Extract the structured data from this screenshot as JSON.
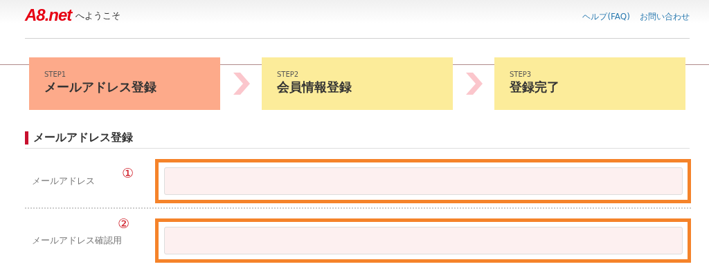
{
  "header": {
    "logo": "A8.net",
    "welcome": "へようこそ",
    "links": [
      "ヘルプ(FAQ)",
      "お問い合わせ"
    ]
  },
  "steps": [
    {
      "step": "STEP1",
      "title": "メールアドレス登録",
      "selected": true
    },
    {
      "step": "STEP2",
      "title": "会員情報登録",
      "selected": false
    },
    {
      "step": "STEP3",
      "title": "登録完了",
      "selected": false
    }
  ],
  "section": {
    "title": "メールアドレス登録"
  },
  "fields": [
    {
      "label": "メールアドレス",
      "marker": "①",
      "highlighted": true
    },
    {
      "label": "メールアドレス確認用",
      "marker": "②",
      "highlighted": true
    }
  ]
}
